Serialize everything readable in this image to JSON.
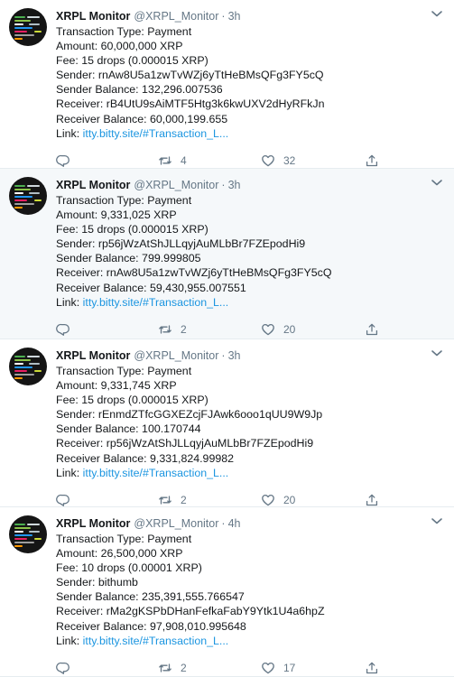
{
  "tweets": [
    {
      "name": "XRPL Monitor",
      "handle": "@XRPL_Monitor",
      "time": "3h",
      "lines": [
        "Transaction Type: Payment",
        "Amount: 60,000,000 XRP",
        "Fee: 15 drops (0.000015 XRP)",
        "Sender: rnAw8U5a1zwTvWZj6yTtHeBMsQFg3FY5cQ",
        "Sender Balance: 132,296.007536",
        "Receiver: rB4UtU9sAiMTF5Htg3k6kwUXV2dHyRFkJn",
        "Receiver Balance: 60,000,199.655"
      ],
      "link_label": "Link:",
      "link_url": "itty.bitty.site/#Transaction_L...",
      "reply_count": "",
      "retweet_count": "4",
      "like_count": "32"
    },
    {
      "name": "XRPL Monitor",
      "handle": "@XRPL_Monitor",
      "time": "3h",
      "lines": [
        "Transaction Type: Payment",
        "Amount: 9,331,025 XRP",
        "Fee: 15 drops (0.000015 XRP)",
        "Sender: rp56jWzAtShJLLqyjAuMLbBr7FZEpodHi9",
        "Sender Balance: 799.999805",
        "Receiver: rnAw8U5a1zwTvWZj6yTtHeBMsQFg3FY5cQ",
        "Receiver Balance: 59,430,955.007551"
      ],
      "link_label": "Link:",
      "link_url": "itty.bitty.site/#Transaction_L...",
      "reply_count": "",
      "retweet_count": "2",
      "like_count": "20"
    },
    {
      "name": "XRPL Monitor",
      "handle": "@XRPL_Monitor",
      "time": "3h",
      "lines": [
        "Transaction Type: Payment",
        "Amount: 9,331,745 XRP",
        "Fee: 15 drops (0.000015 XRP)",
        "Sender: rEnmdZTfcGGXEZcjFJAwk6ooo1qUU9W9Jp",
        "Sender Balance: 100.170744",
        "Receiver: rp56jWzAtShJLLqyjAuMLbBr7FZEpodHi9",
        "Receiver Balance: 9,331,824.99982"
      ],
      "link_label": "Link:",
      "link_url": "itty.bitty.site/#Transaction_L...",
      "reply_count": "",
      "retweet_count": "2",
      "like_count": "20"
    },
    {
      "name": "XRPL Monitor",
      "handle": "@XRPL_Monitor",
      "time": "4h",
      "lines": [
        "Transaction Type: Payment",
        "Amount: 26,500,000 XRP",
        "Fee: 10 drops (0.00001 XRP)",
        "Sender: bithumb",
        "Sender Balance: 235,391,555.766547",
        "Receiver: rMa2gKSPbDHanFefkaFabY9Ytk1U4a6hpZ",
        "Receiver Balance: 97,908,010.995648"
      ],
      "link_label": "Link:",
      "link_url": "itty.bitty.site/#Transaction_L...",
      "reply_count": "",
      "retweet_count": "2",
      "like_count": "17"
    }
  ],
  "icons": {
    "reply": "reply-icon",
    "retweet": "retweet-icon",
    "like": "heart-icon",
    "share": "share-icon",
    "menu": "chevron-down-icon"
  },
  "colors": {
    "name": "#14171a",
    "secondary": "#657786",
    "link": "#1b95e0",
    "highlight_bg": "#f5f8fa",
    "divider": "#e6ecf0",
    "avatar_bg": "#151515"
  }
}
